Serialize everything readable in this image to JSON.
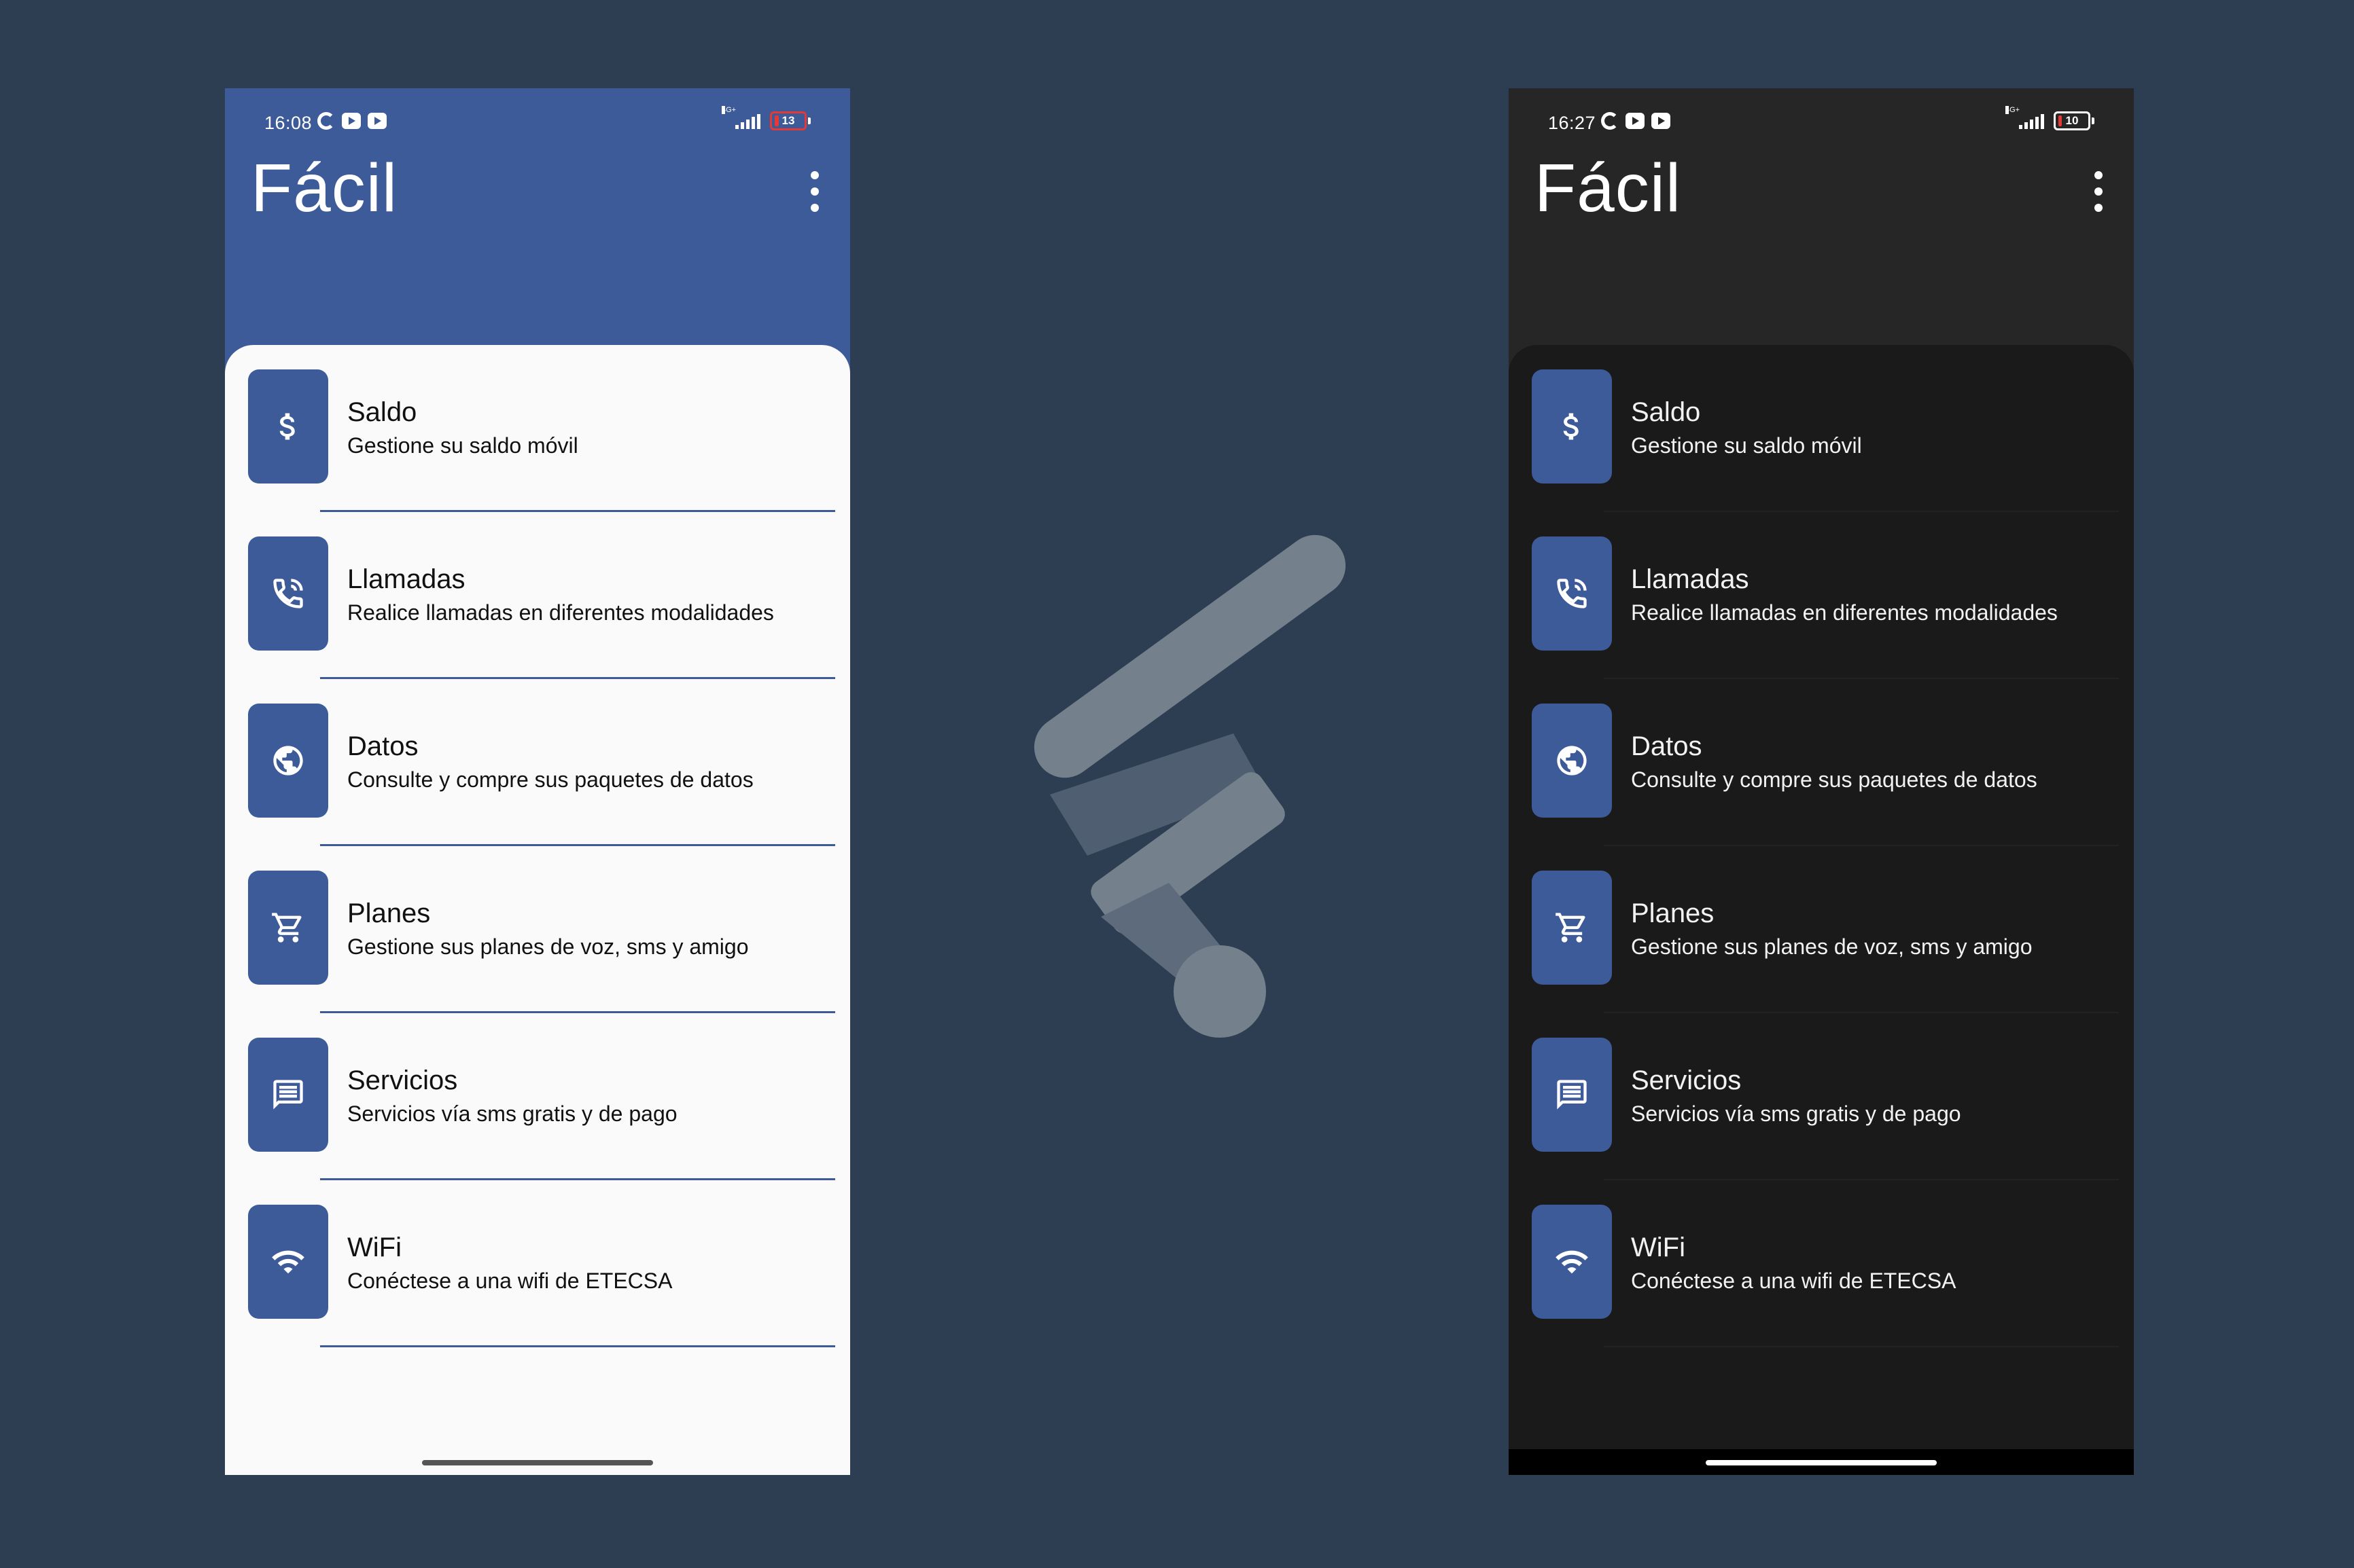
{
  "phones": [
    {
      "theme": "light",
      "status": {
        "time": "16:08",
        "network": "4G+",
        "battery": "13"
      },
      "title": "Fácil",
      "items": [
        {
          "icon": "dollar-icon",
          "title": "Saldo",
          "subtitle": "Gestione su saldo móvil"
        },
        {
          "icon": "phone-call-icon",
          "title": "Llamadas",
          "subtitle": "Realice llamadas en diferentes modalidades"
        },
        {
          "icon": "globe-icon",
          "title": "Datos",
          "subtitle": "Consulte y compre sus paquetes de datos"
        },
        {
          "icon": "cart-icon",
          "title": "Planes",
          "subtitle": "Gestione sus planes de voz, sms y amigo"
        },
        {
          "icon": "message-icon",
          "title": "Servicios",
          "subtitle": "Servicios vía sms gratis y de pago"
        },
        {
          "icon": "wifi-icon",
          "title": "WiFi",
          "subtitle": "Conéctese a una wifi de ETECSA"
        }
      ]
    },
    {
      "theme": "dark",
      "status": {
        "time": "16:27",
        "network": "4G+",
        "battery": "10"
      },
      "title": "Fácil",
      "items": [
        {
          "icon": "dollar-icon",
          "title": "Saldo",
          "subtitle": "Gestione su saldo móvil"
        },
        {
          "icon": "phone-call-icon",
          "title": "Llamadas",
          "subtitle": "Realice llamadas en diferentes modalidades"
        },
        {
          "icon": "globe-icon",
          "title": "Datos",
          "subtitle": "Consulte y compre sus paquetes de datos"
        },
        {
          "icon": "cart-icon",
          "title": "Planes",
          "subtitle": "Gestione sus planes de voz, sms y amigo"
        },
        {
          "icon": "message-icon",
          "title": "Servicios",
          "subtitle": "Servicios vía sms gratis y de pago"
        },
        {
          "icon": "wifi-icon",
          "title": "WiFi",
          "subtitle": "Conéctese a una wifi de ETECSA"
        }
      ]
    }
  ],
  "colors": {
    "background": "#2e3e52",
    "primary": "#3d5a99",
    "light_sheet": "#fafafa",
    "dark_header": "#262626",
    "dark_sheet": "#1a1a1a",
    "battery_low": "#e53935"
  },
  "logo_icon": "facil-logo-icon"
}
